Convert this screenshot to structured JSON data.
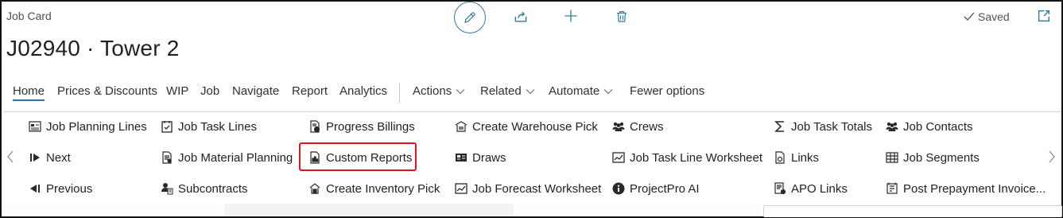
{
  "header": {
    "page_type": "Job Card",
    "title": "J02940 · Tower 2",
    "status": "Saved"
  },
  "toolbar": {
    "icons": [
      "pencil-icon",
      "share-icon",
      "plus-icon",
      "trash-icon",
      "popout-icon"
    ]
  },
  "menu": {
    "items": [
      "Home",
      "Prices & Discounts",
      "WIP",
      "Job",
      "Navigate",
      "Report",
      "Analytics"
    ],
    "dropdowns": [
      "Actions",
      "Related",
      "Automate"
    ],
    "fewer": "Fewer options"
  },
  "actions": {
    "col1": [
      "Job Planning Lines",
      "Next",
      "Previous"
    ],
    "col2": [
      "Job Task Lines",
      "Job Material Planning",
      "Subcontracts"
    ],
    "col3": [
      "Progress Billings",
      "Custom Reports",
      "Create Inventory Pick"
    ],
    "col4": [
      "Create Warehouse Pick",
      "Draws",
      "Job Forecast Worksheet"
    ],
    "col5": [
      "Crews",
      "Job Task Line Worksheet",
      "ProjectPro AI"
    ],
    "col6": [
      "Job Task Totals",
      "Links",
      "APO Links"
    ],
    "col7": [
      "Job Contacts",
      "Job Segments",
      "Post Prepayment Invoice..."
    ]
  },
  "highlighted_action": "Custom Reports",
  "colors": {
    "accent": "#2f78a8",
    "highlight_border": "#e0141e"
  }
}
